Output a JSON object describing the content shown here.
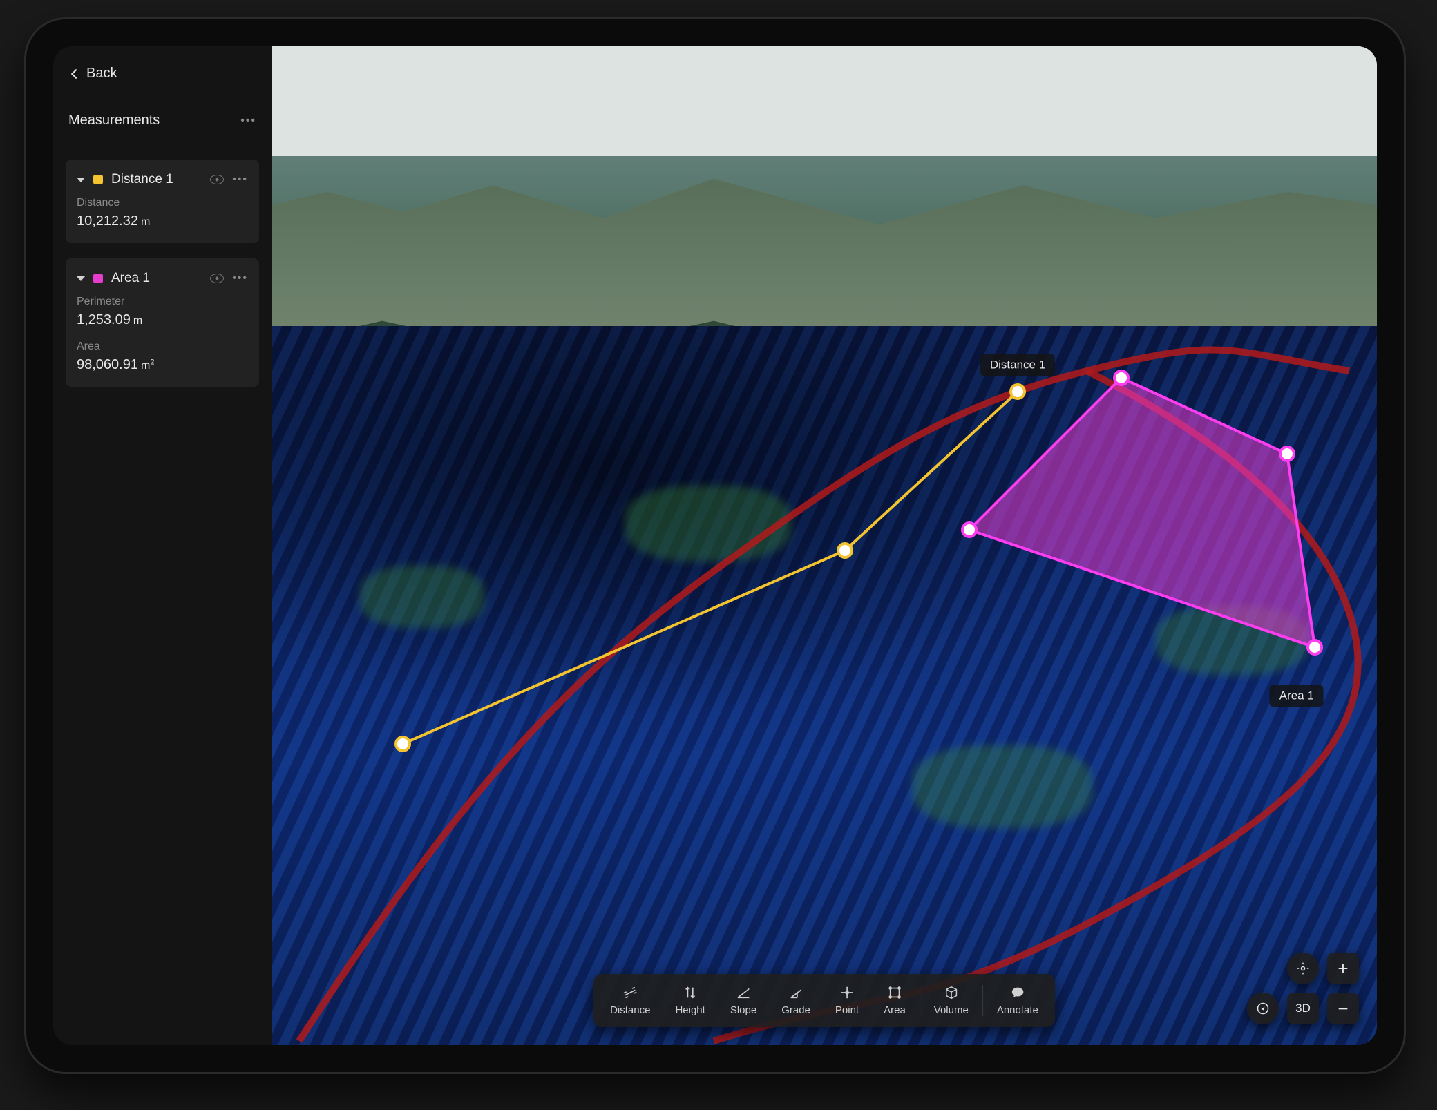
{
  "nav": {
    "back_label": "Back"
  },
  "section": {
    "title": "Measurements"
  },
  "colors": {
    "distance": "#f4c430",
    "area": "#e83ccf",
    "road": "#b11a1a"
  },
  "measurements": [
    {
      "id": "distance1",
      "swatch": "#f4c430",
      "title": "Distance 1",
      "metrics": [
        {
          "label": "Distance",
          "value": "10,212.32",
          "unit": "m"
        }
      ]
    },
    {
      "id": "area1",
      "swatch": "#e83ccf",
      "title": "Area 1",
      "metrics": [
        {
          "label": "Perimeter",
          "value": "1,253.09",
          "unit": "m"
        },
        {
          "label": "Area",
          "value": "98,060.91",
          "unit": "m²"
        }
      ]
    }
  ],
  "map_labels": {
    "distance": "Distance 1",
    "area": "Area 1"
  },
  "toolbar": {
    "items": [
      {
        "id": "distance",
        "label": "Distance"
      },
      {
        "id": "height",
        "label": "Height"
      },
      {
        "id": "slope",
        "label": "Slope"
      },
      {
        "id": "grade",
        "label": "Grade"
      },
      {
        "id": "point",
        "label": "Point"
      },
      {
        "id": "area",
        "label": "Area"
      },
      {
        "id": "volume",
        "label": "Volume"
      },
      {
        "id": "annotate",
        "label": "Annotate"
      }
    ]
  },
  "controls": {
    "mode_label": "3D",
    "zoom_in": "+",
    "zoom_out": "−"
  }
}
